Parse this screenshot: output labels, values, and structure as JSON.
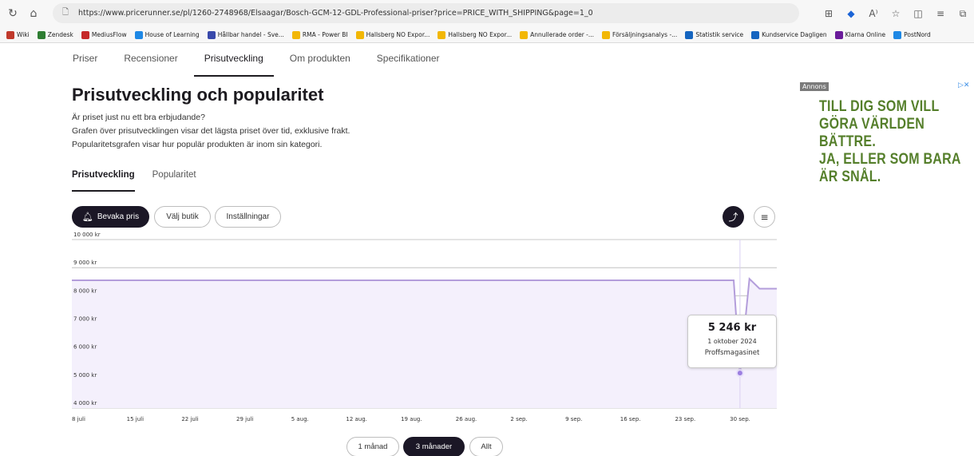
{
  "browser": {
    "url": "https://www.pricerunner.se/pl/1260-2748968/Elsaagar/Bosch-GCM-12-GDL-Professional-priser?price=PRICE_WITH_SHIPPING&page=1_0",
    "bookmarks": [
      {
        "label": "Wiki",
        "icon": "wiki-icon",
        "color": "#c0392b"
      },
      {
        "label": "Zendesk",
        "icon": "zendesk-icon",
        "color": "#2e7d32"
      },
      {
        "label": "MediusFlow",
        "icon": "mediusflow-icon",
        "color": "#c62828"
      },
      {
        "label": "House of Learning",
        "icon": "house-icon",
        "color": "#1e88e5"
      },
      {
        "label": "Hållbar handel - Sve...",
        "icon": "sh-icon",
        "color": "#3949ab"
      },
      {
        "label": "RMA - Power BI",
        "icon": "powerbi-icon",
        "color": "#f2b705"
      },
      {
        "label": "Hallsberg NO Expor...",
        "icon": "powerbi-icon",
        "color": "#f2b705"
      },
      {
        "label": "Hallsberg NO Expor...",
        "icon": "powerbi-icon",
        "color": "#f2b705"
      },
      {
        "label": "Annullerade order -...",
        "icon": "powerbi-icon",
        "color": "#f2b705"
      },
      {
        "label": "Försäljningsanalys -...",
        "icon": "powerbi-icon",
        "color": "#f2b705"
      },
      {
        "label": "Statistik service",
        "icon": "statistik-icon",
        "color": "#1565c0"
      },
      {
        "label": "Kundservice Dagligen",
        "icon": "statistik-icon",
        "color": "#1565c0"
      },
      {
        "label": "Klarna Online",
        "icon": "klarna-icon",
        "color": "#6a1b9a"
      },
      {
        "label": "PostNord",
        "icon": "postnord-icon",
        "color": "#1e88e5"
      }
    ]
  },
  "page_tabs": [
    "Priser",
    "Recensioner",
    "Prisutveckling",
    "Om produkten",
    "Specifikationer"
  ],
  "heading": "Prisutveckling och popularitet",
  "description": [
    "Är priset just nu ett bra erbjudande?",
    "Grafen över prisutvecklingen visar det lägsta priset över tid, exklusive frakt.",
    "Popularitetsgrafen visar hur populär produkten är inom sin kategori."
  ],
  "sub_tabs": [
    "Prisutveckling",
    "Popularitet"
  ],
  "controls": {
    "watch_price": "Bevaka pris",
    "choose_store": "Välj butik",
    "settings": "Inställningar"
  },
  "tooltip": {
    "price": "5 246 kr",
    "date": "1 oktober 2024",
    "store": "Proffsmagasinet"
  },
  "range_buttons": [
    "1 månad",
    "3 månader",
    "Allt"
  ],
  "ad": {
    "label": "Annons",
    "lines": [
      "TILL DIG SOM VILL",
      "GÖRA VÄRLDEN",
      "BÄTTRE.",
      "JA, ELLER SOM BARA",
      "ÄR SNÅL."
    ]
  },
  "chart_data": {
    "type": "line",
    "ytick_labels": [
      "10 000 kr",
      "9 000 kr",
      "8 000 kr",
      "7 000 kr",
      "6 000 kr",
      "5 000 kr",
      "4 000 kr"
    ],
    "ytick_values": [
      10000,
      9000,
      8000,
      7000,
      6000,
      5000,
      4000
    ],
    "ylim": [
      4000,
      10000
    ],
    "xtick_labels": [
      "8 juli",
      "15 juli",
      "22 juli",
      "29 juli",
      "5 aug.",
      "12 aug.",
      "19 aug.",
      "26 aug.",
      "2 sep.",
      "9 sep.",
      "16 sep.",
      "23 sep.",
      "30 sep."
    ],
    "xtick_days": [
      0,
      7,
      14,
      21,
      28,
      35,
      42,
      49,
      56,
      63,
      70,
      77,
      84
    ],
    "xlim_days": [
      0,
      90
    ],
    "series": [
      {
        "points": [
          [
            0,
            8550
          ],
          [
            84.5,
            8550
          ],
          [
            85.3,
            5246
          ],
          [
            86.5,
            8600
          ],
          [
            87.8,
            8250
          ],
          [
            90,
            8250
          ]
        ]
      }
    ],
    "highlight": {
      "day": 85.3,
      "value": 5246
    },
    "line_color": "#b39ddb",
    "fill_color": "#f4f0fc",
    "marker_color": "#9c7fe0"
  }
}
